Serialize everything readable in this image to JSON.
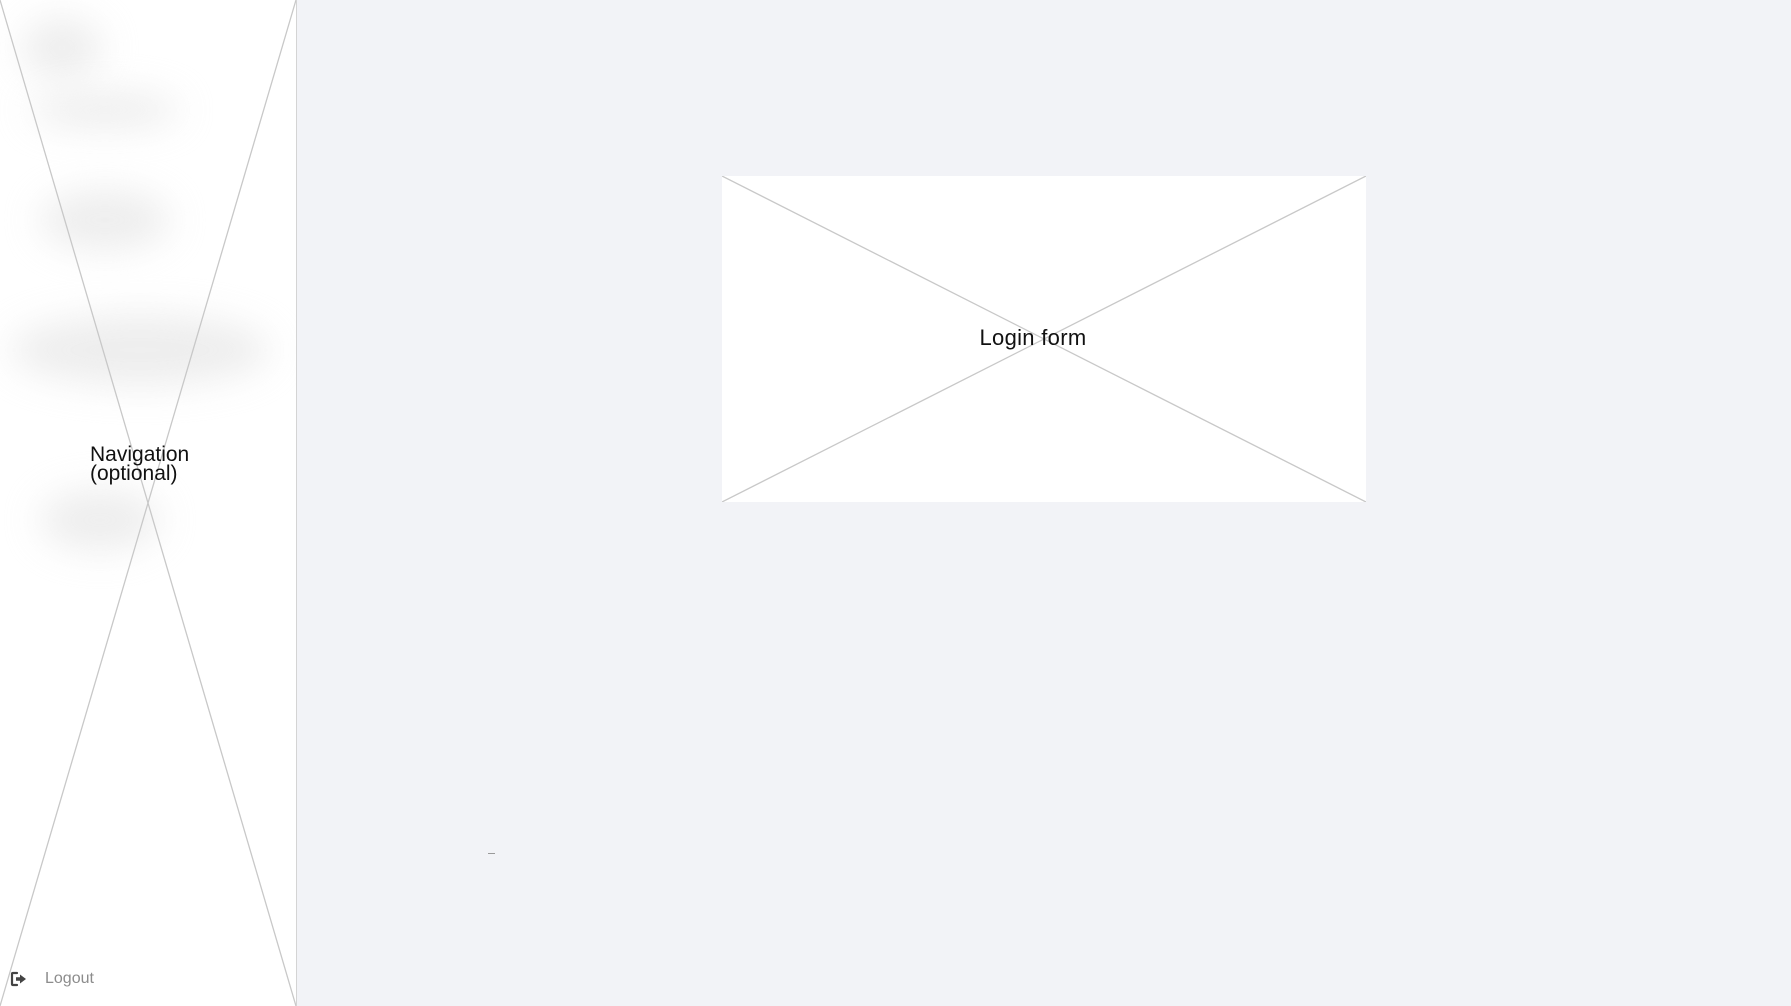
{
  "sidebar": {
    "placeholder_label": "Navigation (optional)",
    "logout": {
      "label": "Logout",
      "icon": "logout-icon"
    }
  },
  "main": {
    "login_placeholder_label": "Login form"
  },
  "colors": {
    "background": "#f2f3f7",
    "panel": "#ffffff",
    "placeholder_line": "#c8c8c8",
    "muted_text": "#8c8c8c",
    "icon": "#444444"
  }
}
